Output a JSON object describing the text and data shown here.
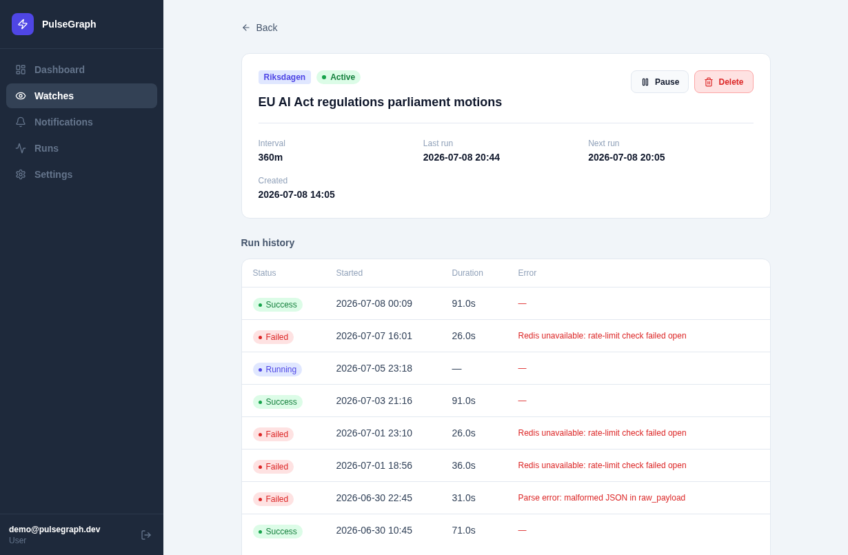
{
  "sidebar": {
    "brand": "PulseGraph",
    "items": [
      {
        "label": "Dashboard",
        "selected": false
      },
      {
        "label": "Watches",
        "selected": true
      },
      {
        "label": "Notifications",
        "selected": false
      },
      {
        "label": "Runs",
        "selected": false
      },
      {
        "label": "Settings",
        "selected": false
      }
    ],
    "user": {
      "email": "demo@pulsegraph.dev",
      "role": "User"
    }
  },
  "back_link": "Back",
  "watch": {
    "tags": [
      {
        "label": "Riksdagen",
        "kind": "source"
      },
      {
        "label": "Active",
        "kind": "active"
      }
    ],
    "title": "EU AI Act regulations parliament motions",
    "actions": [
      {
        "label": "Pause",
        "kind": "pause"
      },
      {
        "label": "Delete",
        "kind": "delete"
      }
    ],
    "details": [
      {
        "label": "Interval",
        "value": "360m"
      },
      {
        "label": "Last run",
        "value": "2026-07-08 20:44"
      },
      {
        "label": "Next run",
        "value": "2026-07-08 20:05"
      },
      {
        "label": "Created",
        "value": "2026-07-08 14:05"
      }
    ]
  },
  "run_history": {
    "title": "Run history",
    "columns": [
      "Status",
      "Started",
      "Duration",
      "Error"
    ],
    "rows": [
      {
        "status": "Success",
        "kind": "success",
        "started": "2026-07-08 00:09",
        "duration": "91.0s",
        "error": "—"
      },
      {
        "status": "Failed",
        "kind": "failed",
        "started": "2026-07-07 16:01",
        "duration": "26.0s",
        "error": "Redis unavailable: rate-limit check failed open"
      },
      {
        "status": "Running",
        "kind": "running",
        "started": "2026-07-05 23:18",
        "duration": "—",
        "error": "—"
      },
      {
        "status": "Success",
        "kind": "success",
        "started": "2026-07-03 21:16",
        "duration": "91.0s",
        "error": "—"
      },
      {
        "status": "Failed",
        "kind": "failed",
        "started": "2026-07-01 23:10",
        "duration": "26.0s",
        "error": "Redis unavailable: rate-limit check failed open"
      },
      {
        "status": "Failed",
        "kind": "failed",
        "started": "2026-07-01 18:56",
        "duration": "36.0s",
        "error": "Redis unavailable: rate-limit check failed open"
      },
      {
        "status": "Failed",
        "kind": "failed",
        "started": "2026-06-30 22:45",
        "duration": "31.0s",
        "error": "Parse error: malformed JSON in raw_payload"
      },
      {
        "status": "Success",
        "kind": "success",
        "started": "2026-06-30 10:45",
        "duration": "71.0s",
        "error": "—"
      }
    ]
  }
}
